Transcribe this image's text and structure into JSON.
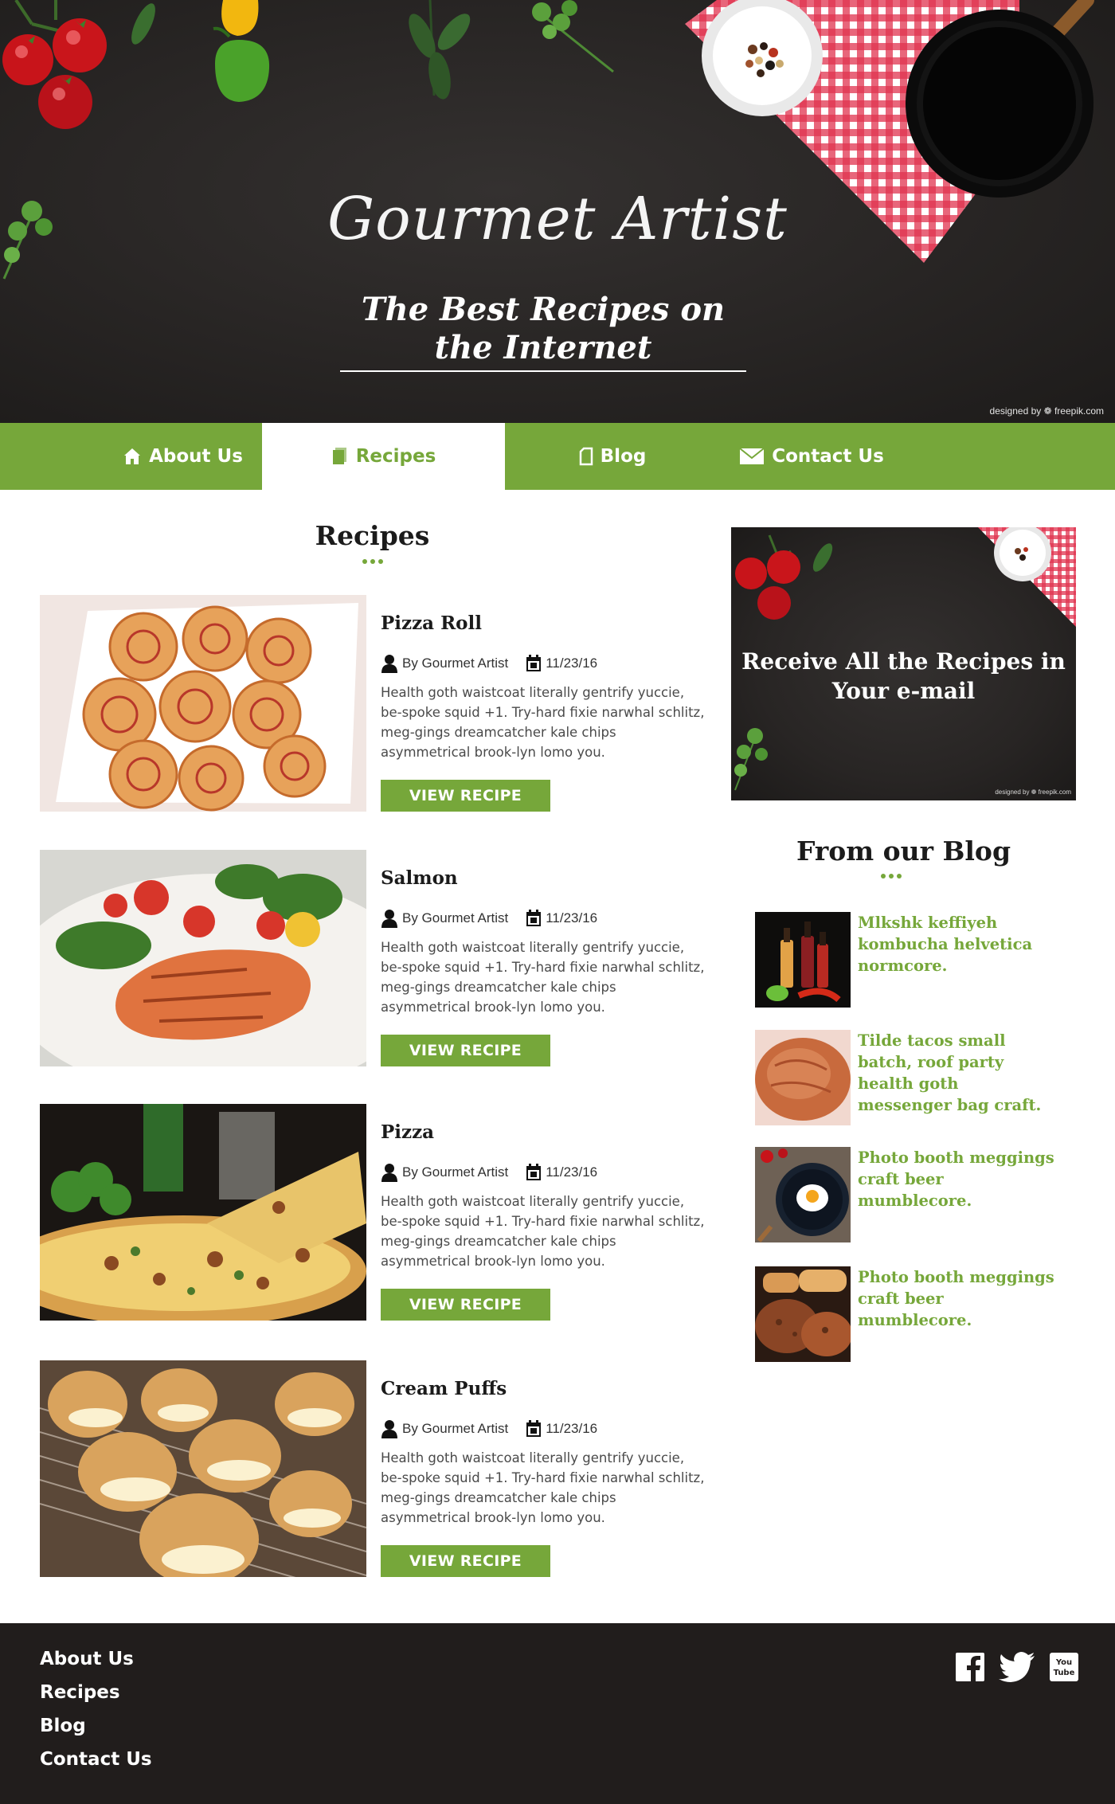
{
  "hero": {
    "title": "Gourmet Artist",
    "subtitle": "The Best Recipes on the Internet",
    "credit": "designed by ❁ freepik.com"
  },
  "nav": {
    "items": [
      {
        "label": "About Us",
        "icon": "house-icon",
        "active": false
      },
      {
        "label": "Recipes",
        "icon": "pages-icon",
        "active": true
      },
      {
        "label": "Blog",
        "icon": "document-icon",
        "active": false
      },
      {
        "label": "Contact Us",
        "icon": "envelope-icon",
        "active": false
      }
    ],
    "accent_color": "#76a73a"
  },
  "recipes": {
    "heading": "Recipes",
    "items": [
      {
        "title": "Pizza Roll",
        "author": "By Gourmet Artist",
        "date": "11/23/16",
        "description": "Health goth waistcoat literally gentrify yuccie, be-spoke squid +1. Try-hard fixie narwhal schlitz, meg-gings dreamcatcher kale chips asymmetrical brook-lyn lomo you.",
        "button": "VIEW RECIPE"
      },
      {
        "title": "Salmon",
        "author": "By Gourmet Artist",
        "date": "11/23/16",
        "description": "Health goth waistcoat literally gentrify yuccie, be-spoke squid +1. Try-hard fixie narwhal schlitz, meg-gings dreamcatcher kale chips asymmetrical brook-lyn lomo you.",
        "button": "VIEW RECIPE"
      },
      {
        "title": "Pizza",
        "author": "By Gourmet Artist",
        "date": "11/23/16",
        "description": "Health goth waistcoat literally gentrify yuccie, be-spoke squid +1. Try-hard fixie narwhal schlitz, meg-gings dreamcatcher kale chips asymmetrical brook-lyn lomo you.",
        "button": "VIEW RECIPE"
      },
      {
        "title": "Cream Puffs",
        "author": "By Gourmet Artist",
        "date": "11/23/16",
        "description": "Health goth waistcoat literally gentrify yuccie, be-spoke squid +1. Try-hard fixie narwhal schlitz, meg-gings dreamcatcher kale chips asymmetrical brook-lyn lomo you.",
        "button": "VIEW RECIPE"
      }
    ]
  },
  "sidebar": {
    "promo_text": "Receive All the Recipes in Your e-mail",
    "promo_credit": "designed by ❁ freepik.com",
    "blog_heading": "From our Blog",
    "blog_items": [
      {
        "title": "Mlkshk keffiyeh kombucha helvetica normcore."
      },
      {
        "title": "Tilde tacos small batch, roof party health goth messenger bag craft."
      },
      {
        "title": " Photo booth meggings craft beer mumblecore."
      },
      {
        "title": " Photo booth meggings craft beer mumblecore."
      }
    ]
  },
  "footer": {
    "links": [
      "About Us",
      "Recipes",
      "Blog",
      "Contact Us"
    ],
    "social": [
      "facebook-icon",
      "twitter-icon",
      "youtube-icon"
    ],
    "background": "#211d1c"
  }
}
